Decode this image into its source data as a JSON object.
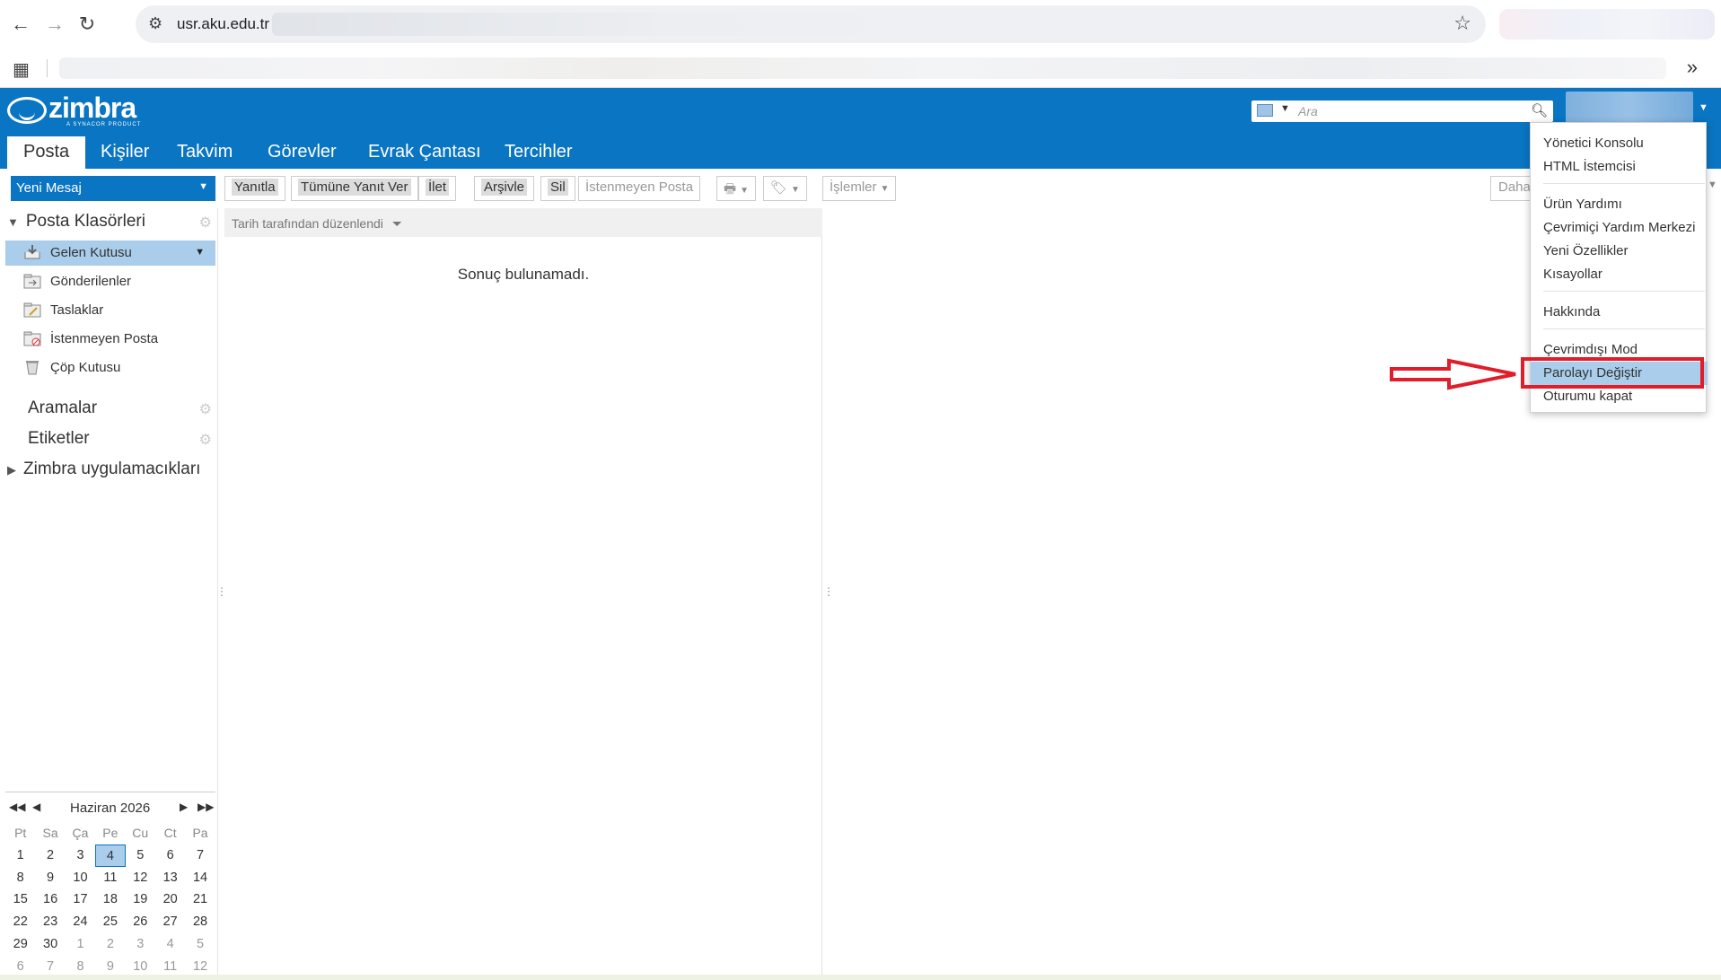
{
  "browser": {
    "url": "usr.aku.edu.tr",
    "back_icon": "←",
    "forward_icon": "→",
    "reload_icon": "↻",
    "star_icon": "☆",
    "more_bookmarks_icon": "»"
  },
  "zimbra": {
    "logo_text": "zimbra",
    "logo_sub": "A SYNACOR PRODUCT",
    "search_placeholder": "Ara",
    "tabs": [
      "Posta",
      "Kişiler",
      "Takvim",
      "Görevler",
      "Evrak Çantası",
      "Tercihler"
    ]
  },
  "toolbar": {
    "new_message": "Yeni Mesaj",
    "reply": "Yanıtla",
    "reply_all": "Tümüne Yanıt Ver",
    "forward": "İlet",
    "archive": "Arşivle",
    "delete": "Sil",
    "spam": "İstenmeyen Posta",
    "actions": "İşlemler",
    "more": "Daha"
  },
  "sidebar": {
    "mail_folders_header": "Posta Klasörleri",
    "folders": [
      "Gelen Kutusu",
      "Gönderilenler",
      "Taslaklar",
      "İstenmeyen Posta",
      "Çöp Kutusu"
    ],
    "searches": "Aramalar",
    "tags": "Etiketler",
    "zimlets": "Zimbra uygulamacıkları"
  },
  "calendar": {
    "month": "Haziran 2026",
    "days_of_week": [
      "Pt",
      "Sa",
      "Ça",
      "Pe",
      "Cu",
      "Ct",
      "Pa"
    ],
    "weeks": [
      [
        "1",
        "2",
        "3",
        "4",
        "5",
        "6",
        "7"
      ],
      [
        "8",
        "9",
        "10",
        "11",
        "12",
        "13",
        "14"
      ],
      [
        "15",
        "16",
        "17",
        "18",
        "19",
        "20",
        "21"
      ],
      [
        "22",
        "23",
        "24",
        "25",
        "26",
        "27",
        "28"
      ],
      [
        "29",
        "30",
        "1",
        "2",
        "3",
        "4",
        "5"
      ],
      [
        "6",
        "7",
        "8",
        "9",
        "10",
        "11",
        "12"
      ]
    ],
    "today": "4"
  },
  "message_list": {
    "sort_label": "Tarih tarafından düzenlendi",
    "empty_text": "Sonuç bulunamadı."
  },
  "user_menu": {
    "items": [
      "Yönetici Konsolu",
      "HTML İstemcisi",
      "Ürün Yardımı",
      "Çevrimiçi Yardım Merkezi",
      "Yeni Özellikler",
      "Kısayollar",
      "Hakkında",
      "Çevrimdışı Mod",
      "Parolayı Değiştir",
      "Oturumu kapat"
    ],
    "highlighted": "Parolayı Değiştir"
  },
  "colors": {
    "zimbra_blue": "#0a75c2",
    "selection": "#a9cdeb",
    "annotation_red": "#e11d2a"
  }
}
